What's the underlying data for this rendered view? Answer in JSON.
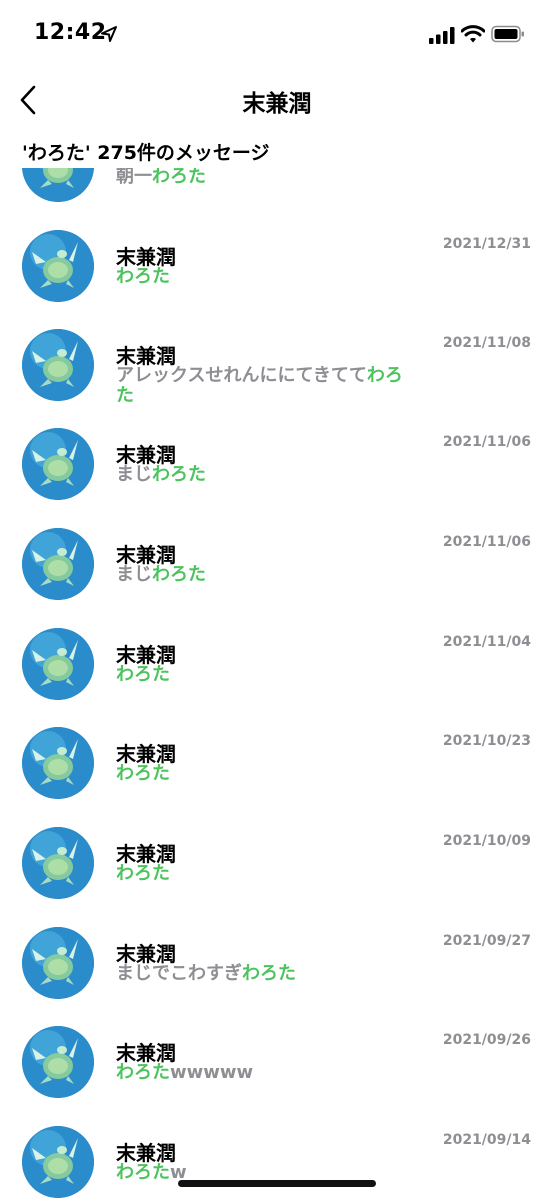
{
  "status_bar": {
    "time": "12:42"
  },
  "nav": {
    "title": "末兼潤"
  },
  "search": {
    "header": "'わろた' 275件のメッセージ"
  },
  "colors": {
    "highlight": "#4cc35d",
    "secondary_text": "#8e8e93"
  },
  "partial_row": {
    "pre": "朝一",
    "hl": "わろた",
    "post": ""
  },
  "rows": [
    {
      "name": "末兼潤",
      "date": "2021/12/31",
      "pre": "",
      "hl": "わろた",
      "post": ""
    },
    {
      "name": "末兼潤",
      "date": "2021/11/08",
      "pre": "アレックスせれんににてきてて",
      "hl": "わろた",
      "post": ""
    },
    {
      "name": "末兼潤",
      "date": "2021/11/06",
      "pre": "まじ",
      "hl": "わろた",
      "post": ""
    },
    {
      "name": "末兼潤",
      "date": "2021/11/06",
      "pre": "まじ",
      "hl": "わろた",
      "post": ""
    },
    {
      "name": "末兼潤",
      "date": "2021/11/04",
      "pre": "",
      "hl": "わろた",
      "post": ""
    },
    {
      "name": "末兼潤",
      "date": "2021/10/23",
      "pre": "",
      "hl": "わろた",
      "post": ""
    },
    {
      "name": "末兼潤",
      "date": "2021/10/09",
      "pre": "",
      "hl": "わろた",
      "post": ""
    },
    {
      "name": "末兼潤",
      "date": "2021/09/27",
      "pre": "まじでこわすぎ",
      "hl": "わろた",
      "post": ""
    },
    {
      "name": "末兼潤",
      "date": "2021/09/26",
      "pre": "",
      "hl": "わろた",
      "post": "wwwww"
    },
    {
      "name": "末兼潤",
      "date": "2021/09/14",
      "pre": "",
      "hl": "わろた",
      "post": "w"
    }
  ]
}
